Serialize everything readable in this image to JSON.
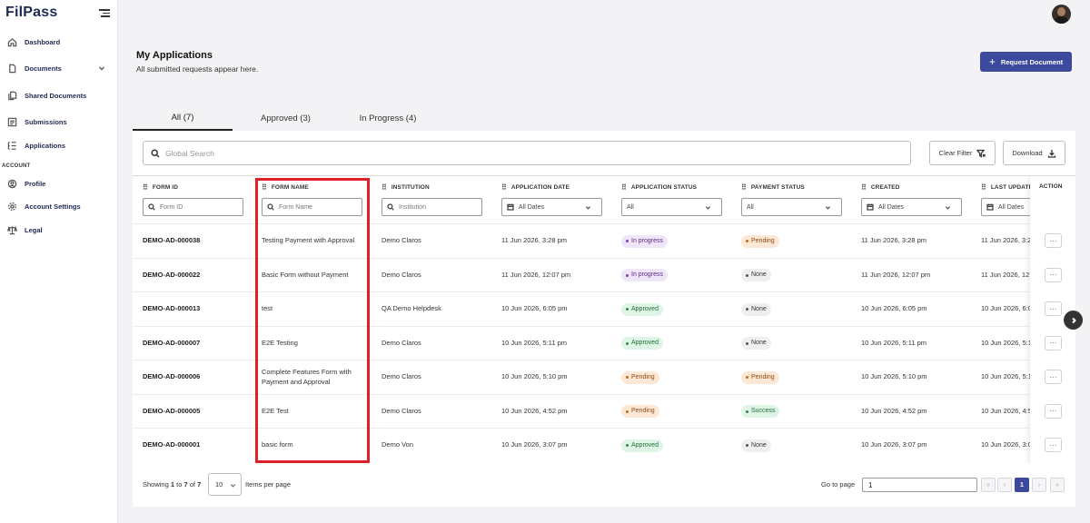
{
  "app": {
    "logo": "FilPass"
  },
  "sidebar": {
    "items": [
      {
        "label": "Dashboard",
        "icon": "home-icon"
      },
      {
        "label": "Documents",
        "icon": "document-icon"
      },
      {
        "label": "Shared Documents",
        "icon": "shared-docs-icon"
      },
      {
        "label": "Submissions",
        "icon": "submissions-icon"
      },
      {
        "label": "Applications",
        "icon": "applications-icon"
      }
    ],
    "section_account": "ACCOUNT",
    "account_items": [
      {
        "label": "Profile",
        "icon": "user-icon"
      },
      {
        "label": "Account Settings",
        "icon": "gear-icon"
      },
      {
        "label": "Legal",
        "icon": "scale-icon"
      }
    ]
  },
  "header": {
    "title": "My Applications",
    "subtitle": "All submitted requests appear here.",
    "request_button": "Request Document"
  },
  "tabs": [
    {
      "label": "All (7)",
      "active": true
    },
    {
      "label": "Approved (3)",
      "active": false
    },
    {
      "label": "In Progress (4)",
      "active": false
    }
  ],
  "toolbar": {
    "search_placeholder": "Global Search",
    "clear_filter": "Clear Filter",
    "download": "Download"
  },
  "table": {
    "columns": [
      "FORM ID",
      "FORM NAME",
      "INSTITUTION",
      "APPLICATION DATE",
      "APPLICATION STATUS",
      "PAYMENT STATUS",
      "CREATED",
      "LAST UPDATED",
      "ACTION"
    ],
    "filters": {
      "form_id": "Form ID",
      "form_name": "Form Name",
      "institution": "Institution",
      "application_date": "All Dates",
      "application_status": "All",
      "payment_status": "All",
      "created": "All Dates",
      "last_updated": "All Dates"
    },
    "action_label": "···",
    "rows": [
      {
        "id": "DEMO-AD-000038",
        "name": "Testing Payment with Approval",
        "institution": "Demo Claros",
        "app_date": "11 Jun 2026, 3:28 pm",
        "app_status": "In progress",
        "pay_status": "Pending",
        "created": "11 Jun 2026, 3:28 pm",
        "updated": "11 Jun 2026, 3:28 pm"
      },
      {
        "id": "DEMO-AD-000022",
        "name": "Basic Form without Payment",
        "institution": "Demo Claros",
        "app_date": "11 Jun 2026, 12:07 pm",
        "app_status": "In progress",
        "pay_status": "None",
        "created": "11 Jun 2026, 12:07 pm",
        "updated": "11 Jun 2026, 12:07 pm"
      },
      {
        "id": "DEMO-AD-000013",
        "name": "test",
        "institution": "QA Demo Helpdesk",
        "app_date": "10 Jun 2026, 6:05 pm",
        "app_status": "Approved",
        "pay_status": "None",
        "created": "10 Jun 2026, 6:05 pm",
        "updated": "10 Jun 2026, 6:05 pm"
      },
      {
        "id": "DEMO-AD-000007",
        "name": "E2E Testing",
        "institution": "Demo Claros",
        "app_date": "10 Jun 2026, 5:11 pm",
        "app_status": "Approved",
        "pay_status": "None",
        "created": "10 Jun 2026, 5:11 pm",
        "updated": "10 Jun 2026, 5:11 pm"
      },
      {
        "id": "DEMO-AD-000006",
        "name": "Complete Features Form with Payment and Approval",
        "institution": "Demo Claros",
        "app_date": "10 Jun 2026, 5:10 pm",
        "app_status": "Pending",
        "pay_status": "Pending",
        "created": "10 Jun 2026, 5:10 pm",
        "updated": "10 Jun 2026, 5:10 pm"
      },
      {
        "id": "DEMO-AD-000005",
        "name": "E2E Test",
        "institution": "Demo Claros",
        "app_date": "10 Jun 2026, 4:52 pm",
        "app_status": "Pending",
        "pay_status": "Success",
        "created": "10 Jun 2026, 4:52 pm",
        "updated": "10 Jun 2026, 4:52 pm"
      },
      {
        "id": "DEMO-AD-000001",
        "name": "basic form",
        "institution": "Demo Von",
        "app_date": "10 Jun 2026, 3:07 pm",
        "app_status": "Approved",
        "pay_status": "None",
        "created": "10 Jun 2026, 3:07 pm",
        "updated": "10 Jun 2026, 3:07 pm"
      }
    ]
  },
  "footer": {
    "showing_prefix": "Showing ",
    "from": "1",
    "to_word": " to ",
    "to": "7",
    "of_word": " of ",
    "total": "7",
    "page_size": "10",
    "items_per_page": "Items per page",
    "go_to_page": "Go to page",
    "go_to_value": "1",
    "pages": [
      "«",
      "‹",
      "1",
      "›",
      "»"
    ]
  },
  "colors": {
    "primary": "#3b4a9c",
    "highlight": "#e21f26"
  }
}
